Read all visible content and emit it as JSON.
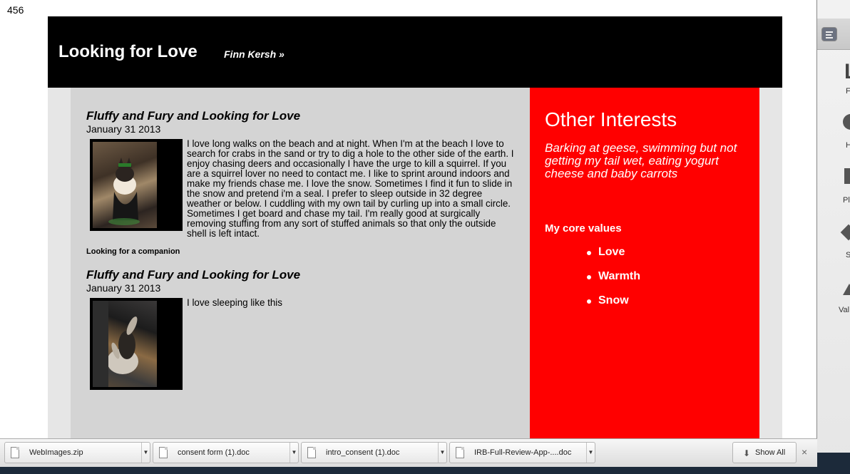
{
  "page_number": "456",
  "site": {
    "title": "Looking for Love",
    "nav_link": "Finn Kersh »"
  },
  "posts": [
    {
      "title": "Fluffy and Fury and Looking for Love",
      "date": "January 31 2013",
      "text": "I love long walks on the beach and at night. When I'm at the beach I love to search for crabs in the sand or try to dig a hole to the other side of the earth. I enjoy chasing deers and occasionally I have the urge to kill a squirrel. If you are a squirrel lover no need to contact me. I like to sprint around indoors and make my friends chase me. I love the snow. Sometimes I find it fun to slide in the snow and pretend i'm a seal. I prefer to sleep outside in 32 degree weather or below. I cuddling with my own tail by curling up into a small circle. Sometimes I get board and chase my tail. I'm really good at surgically removing stuffing from any sort of stuffed animals so that only the outside shell is left intact.",
      "caption": "Looking for a companion"
    },
    {
      "title": "Fluffy and Fury and Looking for Love",
      "date": "January 31 2013",
      "text": "I love sleeping like this"
    }
  ],
  "sidebar": {
    "heading": "Other Interests",
    "interests": "Barking at geese, swimming but not getting my tail wet, eating yogurt cheese and baby carrots",
    "core_values_heading": "My core values",
    "core_values": [
      "Love",
      "Warmth",
      "Snow"
    ],
    "background_color": "#ff0000"
  },
  "downloads": {
    "items": [
      "WebImages.zip",
      "consent form (1).doc",
      "intro_consent (1).doc",
      "IRB-Full-Review-App-....doc"
    ],
    "show_all_label": "Show All",
    "close_glyph": "×"
  },
  "side_app": {
    "letters": [
      "L",
      "F",
      "H",
      "Pl",
      "S",
      "Val"
    ]
  }
}
